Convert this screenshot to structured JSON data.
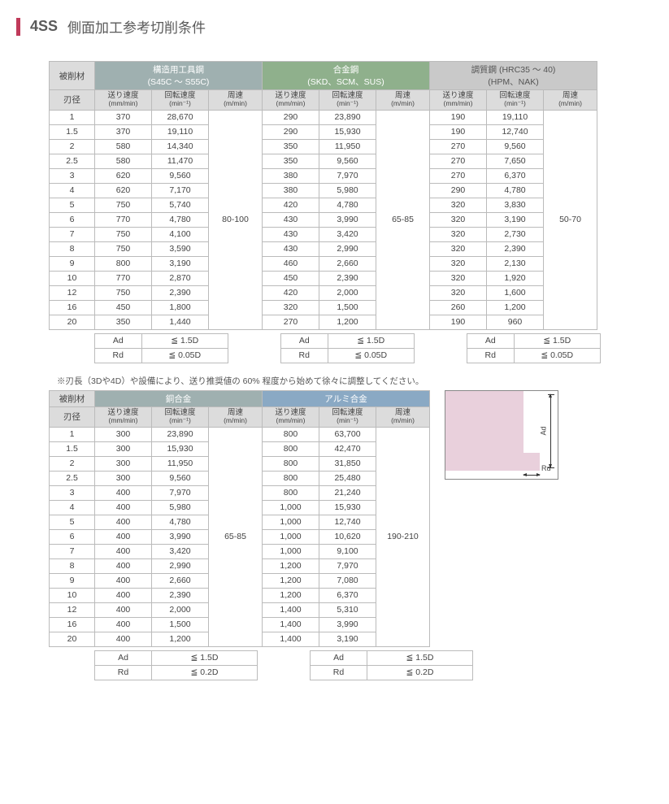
{
  "title": {
    "code": "4SS",
    "jp": "側面加工参考切削条件"
  },
  "headers": {
    "mat": "被削材",
    "dia": "刃径",
    "feed": "送り速度",
    "feed_u": "(mm/min)",
    "rpm": "回転速度",
    "rpm_u": "(min⁻¹)",
    "speed": "周速",
    "speed_u": "(m/min)"
  },
  "groups1": {
    "steel": {
      "l1": "構造用工具鋼",
      "l2": "(S45C ～ S55C)"
    },
    "alloy": {
      "l1": "合金鋼",
      "l2": "(SKD、SCM、SUS)"
    },
    "temp": {
      "l1": "調質鋼 (HRC35 ～ 40)",
      "l2": "(HPM、NAK)"
    }
  },
  "groups2": {
    "copper": "銅合金",
    "alu": "アルミ合金"
  },
  "diameters": [
    "1",
    "1.5",
    "2",
    "2.5",
    "3",
    "4",
    "5",
    "6",
    "7",
    "8",
    "9",
    "10",
    "12",
    "16",
    "20"
  ],
  "t1": {
    "steel": {
      "speed": "80-100",
      "rows": [
        [
          "370",
          "28,670"
        ],
        [
          "370",
          "19,110"
        ],
        [
          "580",
          "14,340"
        ],
        [
          "580",
          "11,470"
        ],
        [
          "620",
          "9,560"
        ],
        [
          "620",
          "7,170"
        ],
        [
          "750",
          "5,740"
        ],
        [
          "770",
          "4,780"
        ],
        [
          "750",
          "4,100"
        ],
        [
          "750",
          "3,590"
        ],
        [
          "800",
          "3,190"
        ],
        [
          "770",
          "2,870"
        ],
        [
          "750",
          "2,390"
        ],
        [
          "450",
          "1,800"
        ],
        [
          "350",
          "1,440"
        ]
      ]
    },
    "alloy": {
      "speed": "65-85",
      "rows": [
        [
          "290",
          "23,890"
        ],
        [
          "290",
          "15,930"
        ],
        [
          "350",
          "11,950"
        ],
        [
          "350",
          "9,560"
        ],
        [
          "380",
          "7,970"
        ],
        [
          "380",
          "5,980"
        ],
        [
          "420",
          "4,780"
        ],
        [
          "430",
          "3,990"
        ],
        [
          "430",
          "3,420"
        ],
        [
          "430",
          "2,990"
        ],
        [
          "460",
          "2,660"
        ],
        [
          "450",
          "2,390"
        ],
        [
          "420",
          "2,000"
        ],
        [
          "320",
          "1,500"
        ],
        [
          "270",
          "1,200"
        ]
      ]
    },
    "temp": {
      "speed": "50-70",
      "rows": [
        [
          "190",
          "19,110"
        ],
        [
          "190",
          "12,740"
        ],
        [
          "270",
          "9,560"
        ],
        [
          "270",
          "7,650"
        ],
        [
          "270",
          "6,370"
        ],
        [
          "290",
          "4,780"
        ],
        [
          "320",
          "3,830"
        ],
        [
          "320",
          "3,190"
        ],
        [
          "320",
          "2,730"
        ],
        [
          "320",
          "2,390"
        ],
        [
          "320",
          "2,130"
        ],
        [
          "320",
          "1,920"
        ],
        [
          "320",
          "1,600"
        ],
        [
          "260",
          "1,200"
        ],
        [
          "190",
          "960"
        ]
      ]
    }
  },
  "adrd1": {
    "ad": "Ad",
    "rd": "Rd",
    "adv": "≦ 1.5D",
    "rdv": "≦ 0.05D"
  },
  "note": "※刃長（3Dや4D）や設備により、送り推奨値の 60% 程度から始めて徐々に調整してください。",
  "t2": {
    "copper": {
      "speed": "65-85",
      "rows": [
        [
          "300",
          "23,890"
        ],
        [
          "300",
          "15,930"
        ],
        [
          "300",
          "11,950"
        ],
        [
          "300",
          "9,560"
        ],
        [
          "400",
          "7,970"
        ],
        [
          "400",
          "5,980"
        ],
        [
          "400",
          "4,780"
        ],
        [
          "400",
          "3,990"
        ],
        [
          "400",
          "3,420"
        ],
        [
          "400",
          "2,990"
        ],
        [
          "400",
          "2,660"
        ],
        [
          "400",
          "2,390"
        ],
        [
          "400",
          "2,000"
        ],
        [
          "400",
          "1,500"
        ],
        [
          "400",
          "1,200"
        ]
      ]
    },
    "alu": {
      "speed": "190-210",
      "rows": [
        [
          "800",
          "63,700"
        ],
        [
          "800",
          "42,470"
        ],
        [
          "800",
          "31,850"
        ],
        [
          "800",
          "25,480"
        ],
        [
          "800",
          "21,240"
        ],
        [
          "1,000",
          "15,930"
        ],
        [
          "1,000",
          "12,740"
        ],
        [
          "1,000",
          "10,620"
        ],
        [
          "1,000",
          "9,100"
        ],
        [
          "1,200",
          "7,970"
        ],
        [
          "1,200",
          "7,080"
        ],
        [
          "1,200",
          "6,370"
        ],
        [
          "1,400",
          "5,310"
        ],
        [
          "1,400",
          "3,990"
        ],
        [
          "1,400",
          "3,190"
        ]
      ]
    }
  },
  "adrd2": {
    "ad": "Ad",
    "rd": "Rd",
    "adv": "≦ 1.5D",
    "rdv": "≦ 0.2D"
  },
  "diagram": {
    "ad": "Ad",
    "rd": "Rd"
  }
}
